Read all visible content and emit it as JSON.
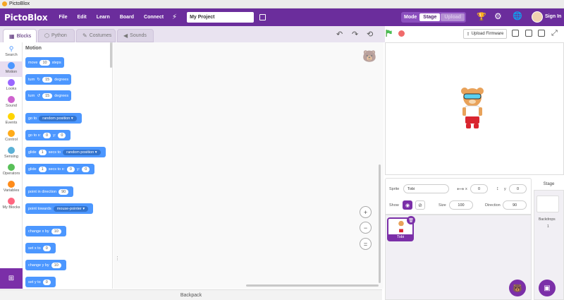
{
  "window": {
    "title": "PictoBlox"
  },
  "menubar": {
    "logo": "PictoBlox",
    "items": [
      "File",
      "Edit",
      "Learn",
      "Board",
      "Connect"
    ],
    "project_name": "My Project",
    "mode_label": "Mode",
    "mode_options": [
      "Stage",
      "Upload"
    ],
    "sign_in": "Sign In"
  },
  "tabs": [
    {
      "label": "Blocks",
      "icon": "blocks-icon"
    },
    {
      "label": "Python",
      "icon": "python-icon"
    },
    {
      "label": "Costumes",
      "icon": "brush-icon"
    },
    {
      "label": "Sounds",
      "icon": "speaker-icon"
    }
  ],
  "toolbar": {
    "upload_firmware": "Upload Firmware"
  },
  "categories": [
    {
      "label": "Search",
      "color": "#ffffff"
    },
    {
      "label": "Motion",
      "color": "#4c97ff"
    },
    {
      "label": "Looks",
      "color": "#9966ff"
    },
    {
      "label": "Sound",
      "color": "#cf63cf"
    },
    {
      "label": "Events",
      "color": "#ffd500"
    },
    {
      "label": "Control",
      "color": "#ffab19"
    },
    {
      "label": "Sensing",
      "color": "#5cb1d6"
    },
    {
      "label": "Operators",
      "color": "#59c059"
    },
    {
      "label": "Variables",
      "color": "#ff8c1a"
    },
    {
      "label": "My Blocks",
      "color": "#ff6680"
    }
  ],
  "palette": {
    "title": "Motion",
    "blocks": [
      {
        "t1": "move",
        "p1": "10",
        "t2": "steps"
      },
      {
        "t1": "turn",
        "icon": "↻",
        "p1": "15",
        "t2": "degrees"
      },
      {
        "t1": "turn",
        "icon": "↺",
        "p1": "15",
        "t2": "degrees"
      },
      {
        "t1": "go to",
        "d1": "random position ▾"
      },
      {
        "t1": "go to x:",
        "p1": "0",
        "t2": "y:",
        "p2": "0"
      },
      {
        "t1": "glide",
        "p1": "1",
        "t2": "secs to",
        "d1": "random position ▾"
      },
      {
        "t1": "glide",
        "p1": "1",
        "t2": "secs to x:",
        "p2": "0",
        "t3": "y:",
        "p3": "0"
      },
      {
        "t1": "point in direction",
        "p1": "90"
      },
      {
        "t1": "point towards",
        "d1": "mouse-pointer ▾"
      },
      {
        "t1": "change x by",
        "p1": "10"
      },
      {
        "t1": "set x to",
        "p1": "0"
      },
      {
        "t1": "change y by",
        "p1": "10"
      },
      {
        "t1": "set y to",
        "p1": "0"
      }
    ]
  },
  "workspace": {
    "backpack": "Backpack"
  },
  "sprite_info": {
    "sprite_label": "Sprite",
    "sprite_name": "Tobi",
    "x_label": "x",
    "x": "0",
    "y_label": "y",
    "y": "0",
    "show_label": "Show",
    "size_label": "Size",
    "size": "100",
    "direction_label": "Direction",
    "direction": "90"
  },
  "sprites": [
    {
      "name": "Tobi"
    }
  ],
  "stage_panel": {
    "title": "Stage",
    "backdrops_label": "Backdrops",
    "backdrops_count": "1"
  }
}
